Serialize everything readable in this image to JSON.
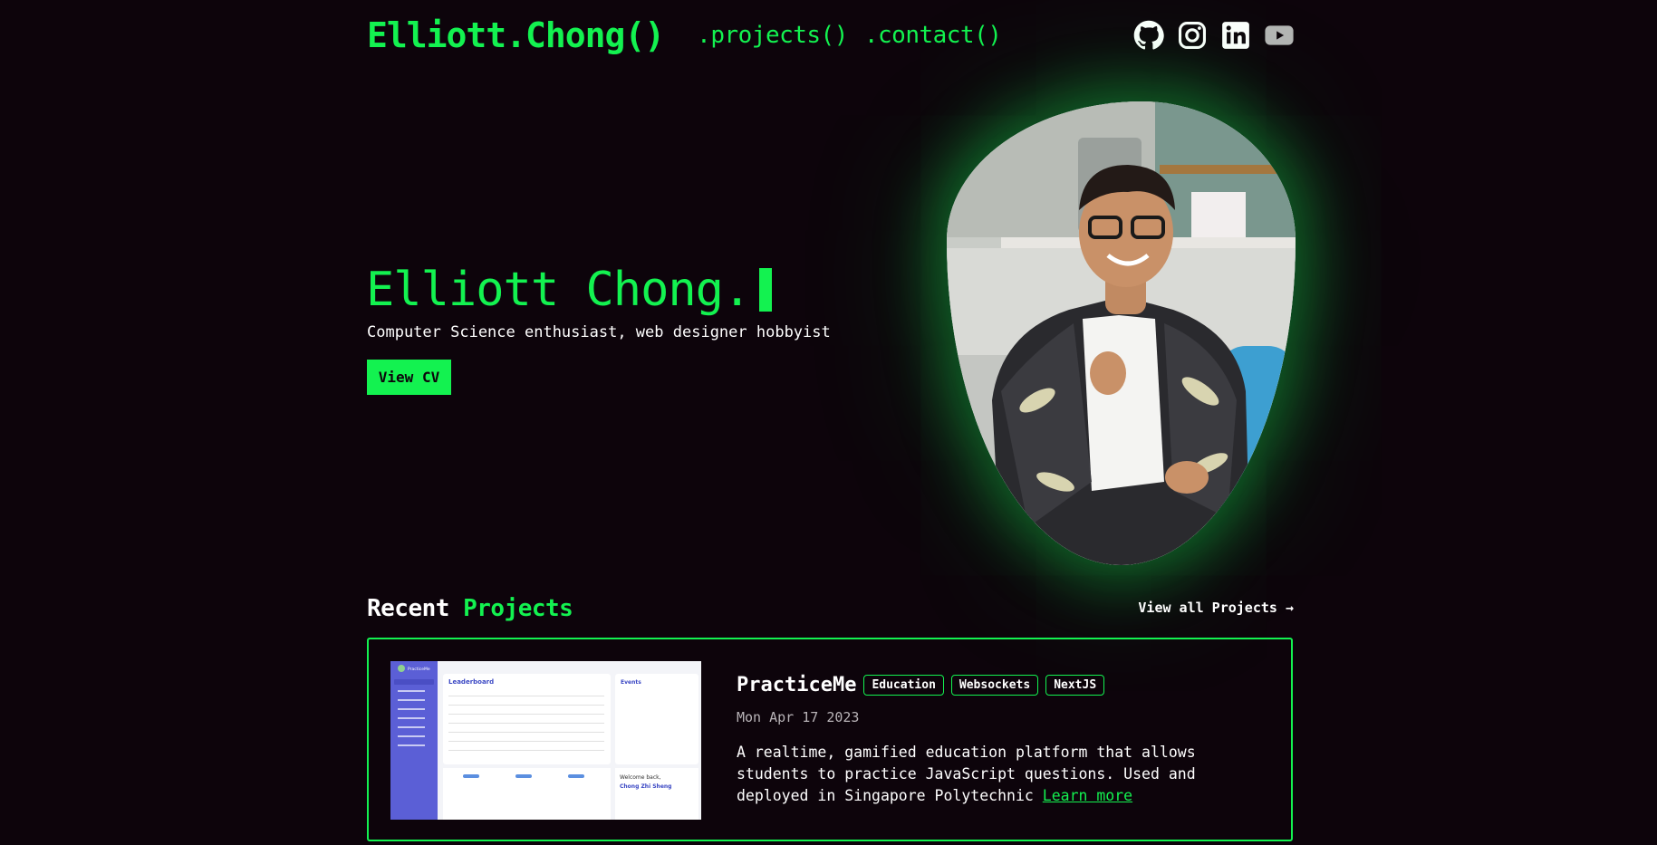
{
  "header": {
    "brand": "Elliott.Chong()",
    "nav": [
      ".projects()",
      ".contact()"
    ],
    "socials": [
      "github-icon",
      "instagram-icon",
      "linkedin-icon",
      "youtube-icon"
    ]
  },
  "hero": {
    "name": "Elliott Chong.",
    "tagline": "Computer Science enthusiast, web designer hobbyist",
    "cv_button": "View CV"
  },
  "projects": {
    "title_part1": "Recent",
    "title_part2": "Projects",
    "view_all": "View all Projects →",
    "items": [
      {
        "title": "PracticeMe",
        "tags": [
          "Education",
          "Websockets",
          "NextJS"
        ],
        "date": "Mon Apr 17 2023",
        "description": "A realtime, gamified education platform that allows students to practice JavaScript questions. Used and deployed in Singapore Polytechnic",
        "link_text": "Learn more",
        "thumbnail": {
          "app_name": "PracticeMe",
          "board_title": "Leaderboard",
          "events_title": "Events",
          "welcome": "Welcome back,",
          "user": "Chong Zhi Sheng"
        }
      }
    ]
  },
  "colors": {
    "accent": "#13f250",
    "background": "#0d040b",
    "text": "#ffffff"
  }
}
